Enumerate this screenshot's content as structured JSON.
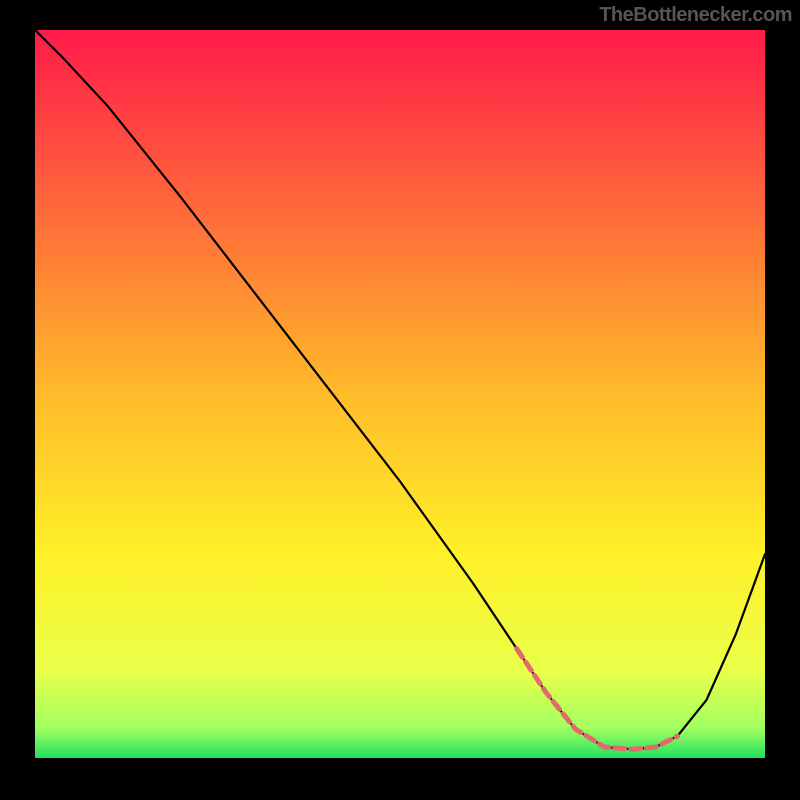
{
  "watermark": "TheBottlenecker.com",
  "chart_data": {
    "type": "line",
    "title": "",
    "xlabel": "",
    "ylabel": "",
    "xlim": [
      0,
      100
    ],
    "ylim": [
      0,
      100
    ],
    "gradient_stops": [
      {
        "offset": 0,
        "color": "#ff1a4a"
      },
      {
        "offset": 25,
        "color": "#ff6a3a"
      },
      {
        "offset": 50,
        "color": "#ffbb2a"
      },
      {
        "offset": 72,
        "color": "#fff028"
      },
      {
        "offset": 88,
        "color": "#eaff4a"
      },
      {
        "offset": 96,
        "color": "#a0ff60"
      },
      {
        "offset": 100,
        "color": "#20e060"
      }
    ],
    "series": [
      {
        "name": "bottleneck-curve",
        "color": "#000000",
        "width": 2.2,
        "x": [
          0,
          4,
          10,
          20,
          30,
          40,
          50,
          60,
          66,
          70,
          74,
          78,
          82,
          85,
          88,
          92,
          96,
          100
        ],
        "y": [
          100,
          96,
          89.5,
          77,
          64,
          51,
          38,
          24,
          15,
          9,
          4,
          1.5,
          1.2,
          1.5,
          3,
          8,
          17,
          28
        ]
      },
      {
        "name": "optimal-range",
        "color": "#e26a6a",
        "width": 5,
        "dash": [
          10,
          6
        ],
        "x": [
          66,
          70,
          74,
          78,
          82,
          85,
          88
        ],
        "y": [
          15,
          9,
          4,
          1.5,
          1.2,
          1.5,
          3
        ]
      }
    ]
  }
}
